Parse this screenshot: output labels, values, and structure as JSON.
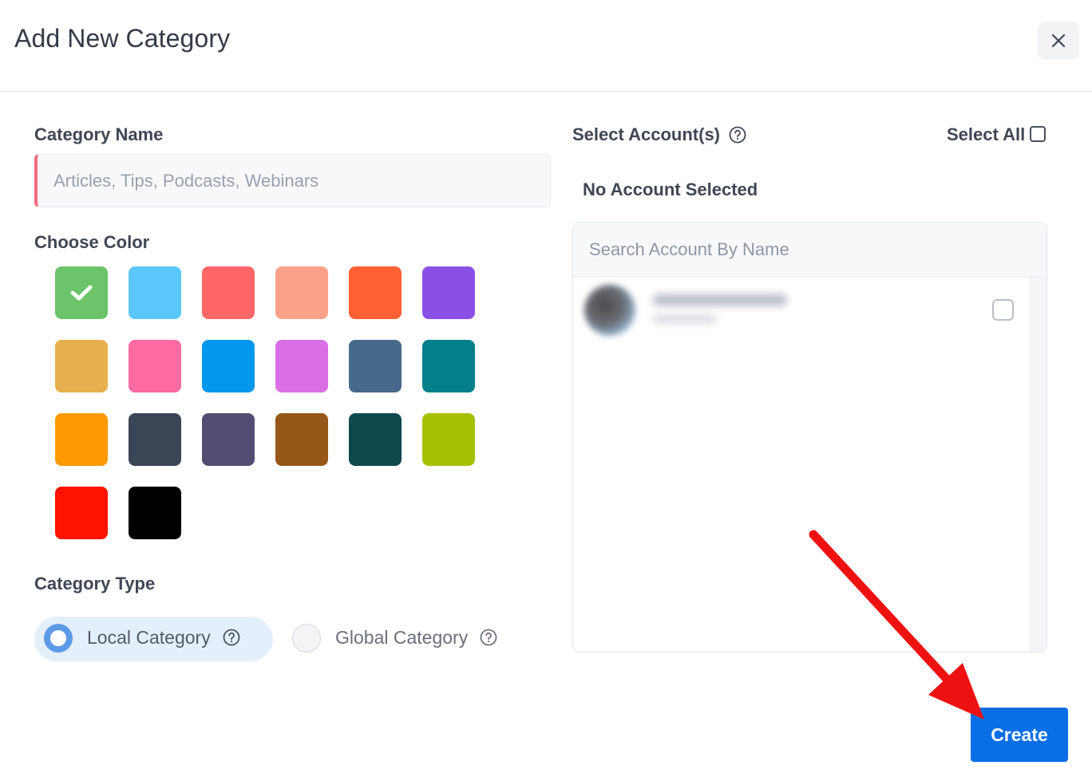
{
  "dialog": {
    "title": "Add New Category"
  },
  "form": {
    "category_name_label": "Category Name",
    "category_name_placeholder": "Articles, Tips, Podcasts, Webinars",
    "category_name_value": "",
    "choose_color_label": "Choose Color",
    "colors": [
      "#6cc46a",
      "#5bc8fd",
      "#fe6667",
      "#fea18b",
      "#fe6033",
      "#8a50e6",
      "#e6b04e",
      "#fd6ba2",
      "#0497ee",
      "#da6fe5",
      "#47698c",
      "#037f8a",
      "#fe9a03",
      "#3a4556",
      "#544d73",
      "#965718",
      "#0e474c",
      "#a8c003",
      "#fe1200",
      "#000000"
    ],
    "selected_color": "#6cc46a",
    "category_type_label": "Category Type",
    "type_options": [
      {
        "label": "Local Category",
        "selected": true
      },
      {
        "label": "Global Category",
        "selected": false
      }
    ]
  },
  "accounts": {
    "label": "Select Account(s)",
    "select_all_label": "Select All",
    "select_all_checked": false,
    "status_text": "No Account Selected",
    "search_placeholder": "Search Account By Name",
    "items": [
      {
        "checked": false
      }
    ]
  },
  "footer": {
    "create_label": "Create"
  },
  "annotation": {
    "color": "#ee1111"
  }
}
